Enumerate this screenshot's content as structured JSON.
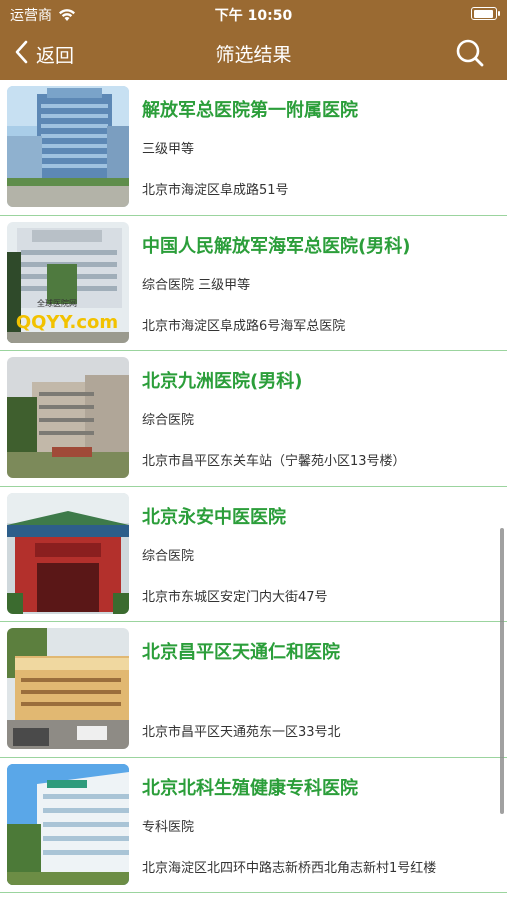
{
  "status": {
    "carrier": "运营商",
    "time": "下午 10:50",
    "battery_level": 0.95
  },
  "nav": {
    "back_label": "返回",
    "title": "筛选结果"
  },
  "hospitals": [
    {
      "name": "解放军总医院第一附属医院",
      "level": "三级甲等",
      "address": "北京市海淀区阜成路51号"
    },
    {
      "name": "中国人民解放军海军总医院(男科)",
      "level": "综合医院 三级甲等",
      "address": "北京市海淀区阜成路6号海军总医院"
    },
    {
      "name": "北京九洲医院(男科)",
      "level": "综合医院",
      "address": "北京市昌平区东关车站（宁馨苑小区13号楼）"
    },
    {
      "name": "北京永安中医医院",
      "level": "综合医院",
      "address": "北京市东城区安定门内大街47号"
    },
    {
      "name": "北京昌平区天通仁和医院",
      "level": "",
      "address": "北京市昌平区天通苑东一区33号北"
    },
    {
      "name": "北京北科生殖健康专科医院",
      "level": "专科医院",
      "address": "北京海淀区北四环中路志新桥西北角志新村1号红楼"
    }
  ],
  "thumb_text": {
    "watermark": "全球医院网",
    "logo": "QQYY.com"
  },
  "colors": {
    "header": "#9a6a32",
    "name_text": "#2b9e3a",
    "divider": "#9bd49e"
  },
  "icons": {
    "back": "chevron-left-icon",
    "search": "search-icon",
    "wifi": "wifi-icon",
    "battery": "battery-icon"
  }
}
